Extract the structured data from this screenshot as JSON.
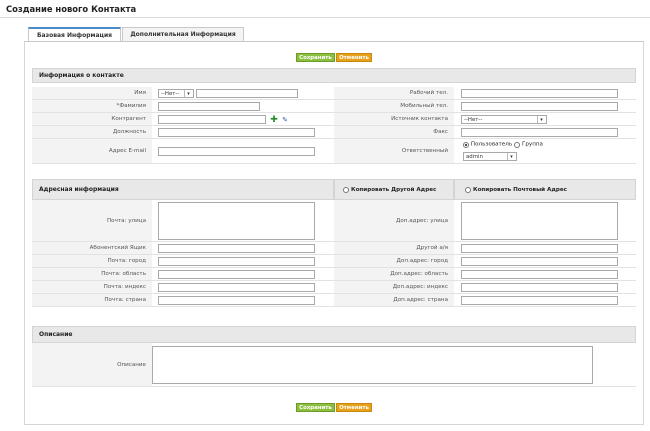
{
  "page": {
    "title": "Создание нового Контакта"
  },
  "tabs": [
    {
      "label": "Базовая Информация",
      "active": true
    },
    {
      "label": "Дополнительная Информация",
      "active": false
    }
  ],
  "actions": {
    "save_label": "Сохранить",
    "cancel_label": "Отменить"
  },
  "contact_section": {
    "title": "Информация о контакте",
    "left": {
      "first_name_label": "Имя",
      "salutation_value": "--Нет--",
      "first_name_value": "",
      "last_name_label": "*Фамилия",
      "last_name_value": "",
      "account_label": "Контрагент",
      "account_value": "",
      "title_label": "Должность",
      "title_value": "",
      "email_label": "Адрес E-mail",
      "email_value": ""
    },
    "right": {
      "work_phone_label": "Рабочий тел.",
      "work_phone_value": "",
      "mobile_label": "Мобильный тел.",
      "mobile_value": "",
      "source_label": "Источник контакта",
      "source_value": "--Нет--",
      "fax_label": "Факс",
      "fax_value": "",
      "assigned_label": "Ответственный",
      "assigned_user_label": "Пользователь",
      "assigned_group_label": "Группа",
      "assigned_value": "admin"
    }
  },
  "address_section": {
    "title": "Адресная информация",
    "copy_other_label": "Копировать Другой Адрес",
    "copy_mailing_label": "Копировать Почтовый Адрес",
    "left": {
      "street_label": "Почта: улица",
      "pobox_label": "Абонентский Ящик",
      "city_label": "Почта: город",
      "state_label": "Почта: область",
      "zip_label": "Почта: индекс",
      "country_label": "Почта: страна"
    },
    "right": {
      "street_label": "Доп.адрес: улица",
      "pobox_label": "Другой а/я",
      "city_label": "Доп.адрес: город",
      "state_label": "Доп.адрес: область",
      "zip_label": "Доп.адрес: индекс",
      "country_label": "Доп.адрес: страна"
    }
  },
  "description_section": {
    "title": "Описание",
    "description_label": "Описание",
    "description_value": ""
  }
}
